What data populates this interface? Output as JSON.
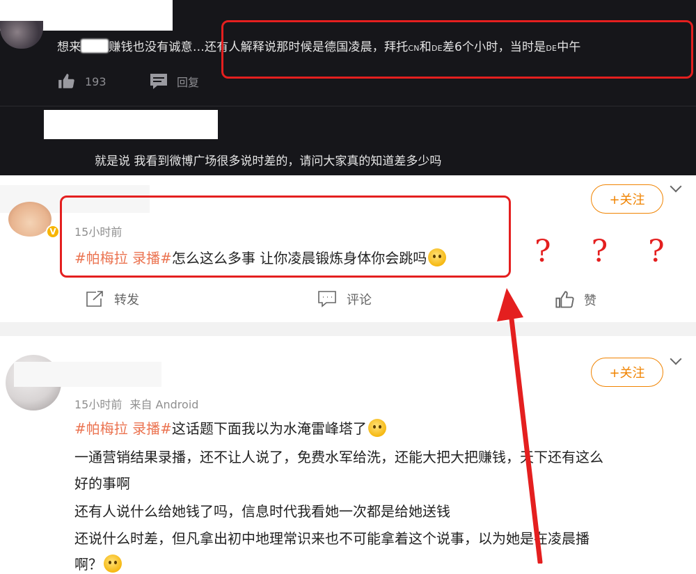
{
  "comment_top": {
    "text_start": "想来",
    "text_mid": "赚钱也没有诚意",
    "text_rest_1": "…还有人解释说那时候是德国凌晨，拜托",
    "cn": "CN",
    "and": "和",
    "de": "DE",
    "text_rest_2": "差6个小时，当时是",
    "de2": "DE",
    "text_rest_3": "中午",
    "like_count": "193",
    "reply_label": "回复"
  },
  "sub_reply": {
    "text": "就是说 我看到微博广场很多说时差的，请问大家真的知道差多少吗"
  },
  "post1": {
    "time": "15小时前",
    "topic": "#帕梅拉 录播#",
    "text": "怎么这么多事 让你凌晨锻炼身体你会跳吗",
    "follow_label": "+关注",
    "actions": {
      "repost": "转发",
      "comment": "评论",
      "like": "赞"
    }
  },
  "annotation": {
    "question_marks": "? ? ?"
  },
  "post2": {
    "time": "15小时前",
    "source": "来自 Android",
    "topic": "#帕梅拉 录播#",
    "line1": "这话题下面我以为水淹雷峰塔了",
    "line2": "一通营销结果录播，还不让人说了，免费水军给洗，还能大把大把赚钱，天下还有这么",
    "line3": "好的事啊",
    "line4": "还有人说什么给她钱了吗，信息时代我看她一次都是给她送钱",
    "line5": "还说什么时差，但凡拿出初中地理常识来也不可能拿着这个说事，以为她是在凌晨播",
    "line6": "啊？",
    "follow_label": "+关注"
  },
  "colors": {
    "accent_orange": "#f08300",
    "topic_color": "#eb7350",
    "annotation_red": "#e41f1f",
    "dark_bg": "#16161a"
  }
}
